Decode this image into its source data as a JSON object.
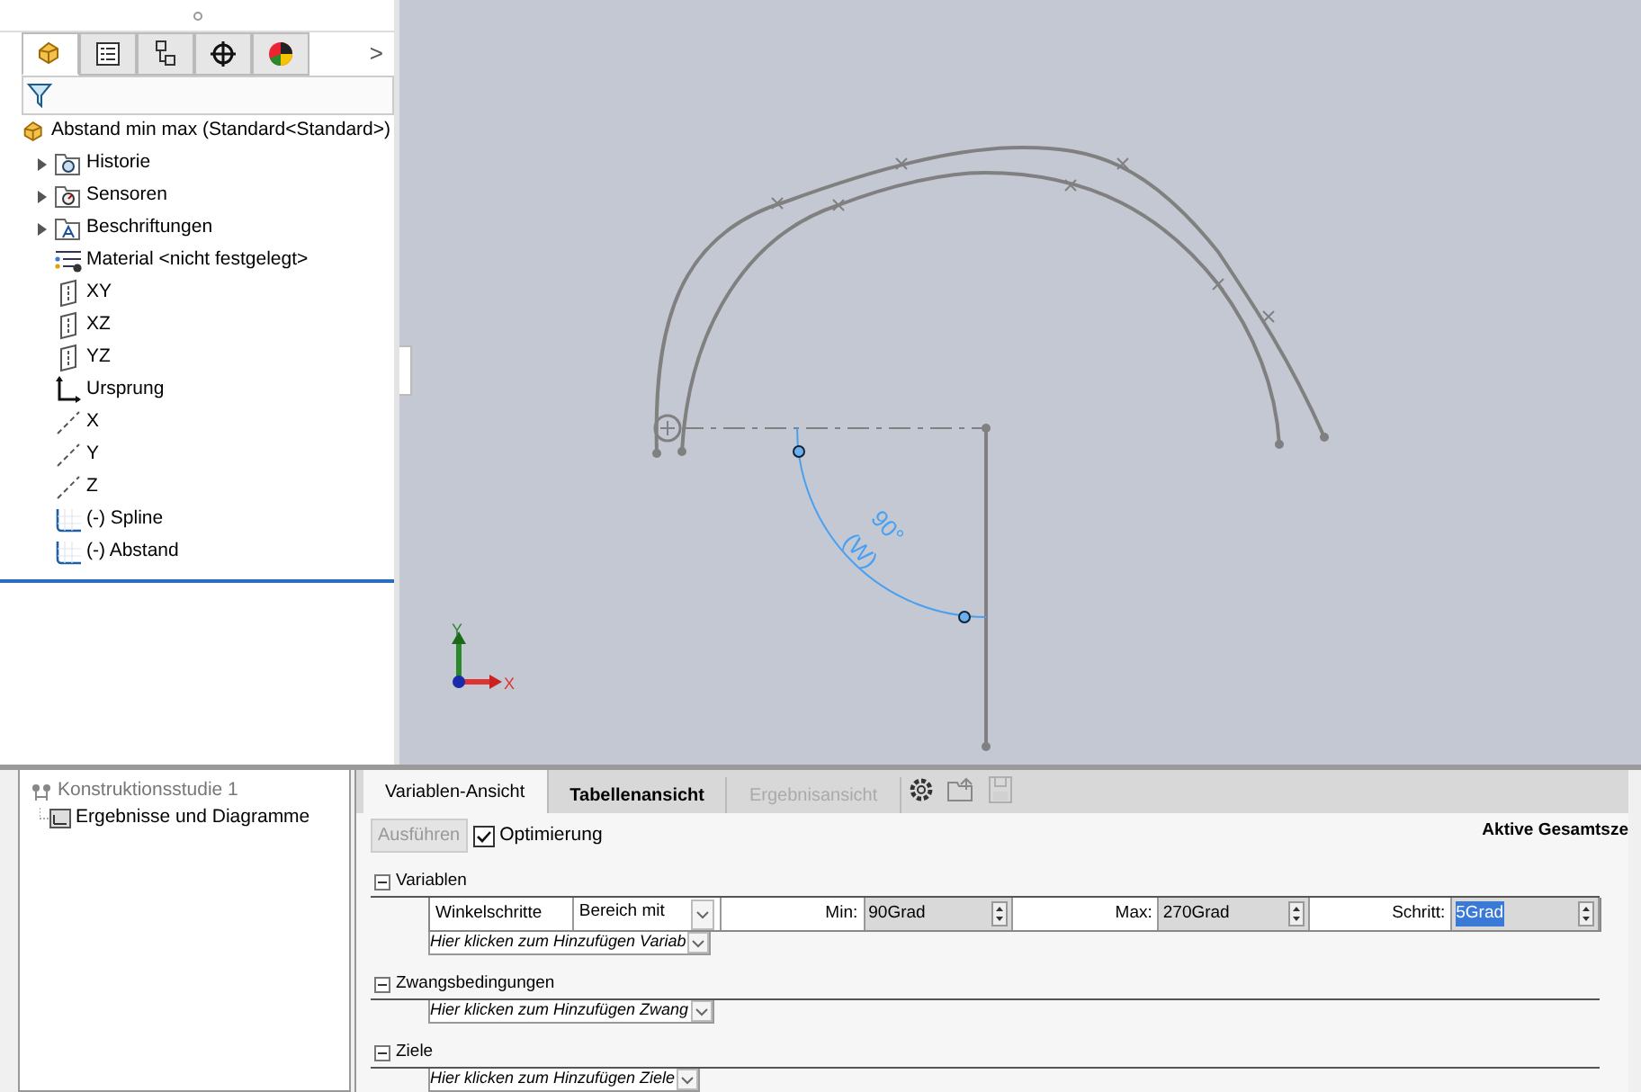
{
  "feature_tree": {
    "tabs": [
      {
        "kind": "part",
        "selected": true
      },
      {
        "kind": "properties",
        "selected": false
      },
      {
        "kind": "config",
        "selected": false
      },
      {
        "kind": "dimxpert",
        "selected": false
      },
      {
        "kind": "display",
        "selected": false
      }
    ],
    "more": ">",
    "root": {
      "label": "Abstand min max  (Standard<Standard>)",
      "kind": "part",
      "children": [
        {
          "label": "Historie",
          "kind": "history",
          "expandable": true
        },
        {
          "label": "Sensoren",
          "kind": "sensor",
          "expandable": true
        },
        {
          "label": "Beschriftungen",
          "kind": "annotation",
          "expandable": true
        },
        {
          "label": "Material <nicht festgelegt>",
          "kind": "material",
          "expandable": false
        },
        {
          "label": "XY",
          "kind": "plane",
          "expandable": false
        },
        {
          "label": "XZ",
          "kind": "plane",
          "expandable": false
        },
        {
          "label": "YZ",
          "kind": "plane",
          "expandable": false
        },
        {
          "label": "Ursprung",
          "kind": "origin",
          "expandable": false
        },
        {
          "label": "X",
          "kind": "axis",
          "expandable": false
        },
        {
          "label": "Y",
          "kind": "axis",
          "expandable": false
        },
        {
          "label": "Z",
          "kind": "axis",
          "expandable": false
        },
        {
          "label": "(-) Spline",
          "kind": "sketch",
          "expandable": false
        },
        {
          "label": "(-) Abstand",
          "kind": "sketch",
          "expandable": false
        }
      ]
    }
  },
  "viewport": {
    "dimension": {
      "value": "90°",
      "name": "(W)"
    },
    "triad": {
      "y": "Y",
      "x": "X"
    }
  },
  "study_tree": {
    "label": "Konstruktionsstudie 1",
    "children": [
      {
        "label": "Ergebnisse und Diagramme"
      }
    ]
  },
  "study": {
    "tabs": [
      {
        "label": "Variablen-Ansicht",
        "selected": true,
        "disabled": false
      },
      {
        "label": "Tabellenansicht",
        "selected": false,
        "disabled": false
      },
      {
        "label": "Ergebnisansicht",
        "selected": false,
        "disabled": true
      }
    ],
    "toolbar": [
      {
        "kind": "settings",
        "disabled": false
      },
      {
        "kind": "open",
        "disabled": false
      },
      {
        "kind": "save",
        "disabled": true
      }
    ],
    "run_button": {
      "label": "Ausführen",
      "disabled": true
    },
    "optimization": {
      "label": "Optimierung",
      "checked": true
    },
    "total_label": "Aktive Gesamtsze",
    "sections": [
      {
        "title": "Variablen",
        "expanded": true,
        "rows": [
          {
            "name": "Winkelschritte",
            "type": "Bereich mit",
            "min_label": "Min:",
            "min": "90Grad",
            "max_label": "Max:",
            "max": "270Grad",
            "step_label": "Schritt:",
            "step": "5Grad"
          }
        ],
        "add": "Hier klicken zum Hinzufügen Variab"
      },
      {
        "title": "Zwangsbedingungen",
        "expanded": true,
        "add": "Hier klicken zum Hinzufügen Zwang"
      },
      {
        "title": "Ziele",
        "expanded": true,
        "add": "Hier klicken zum Hinzufügen Ziele"
      }
    ]
  }
}
